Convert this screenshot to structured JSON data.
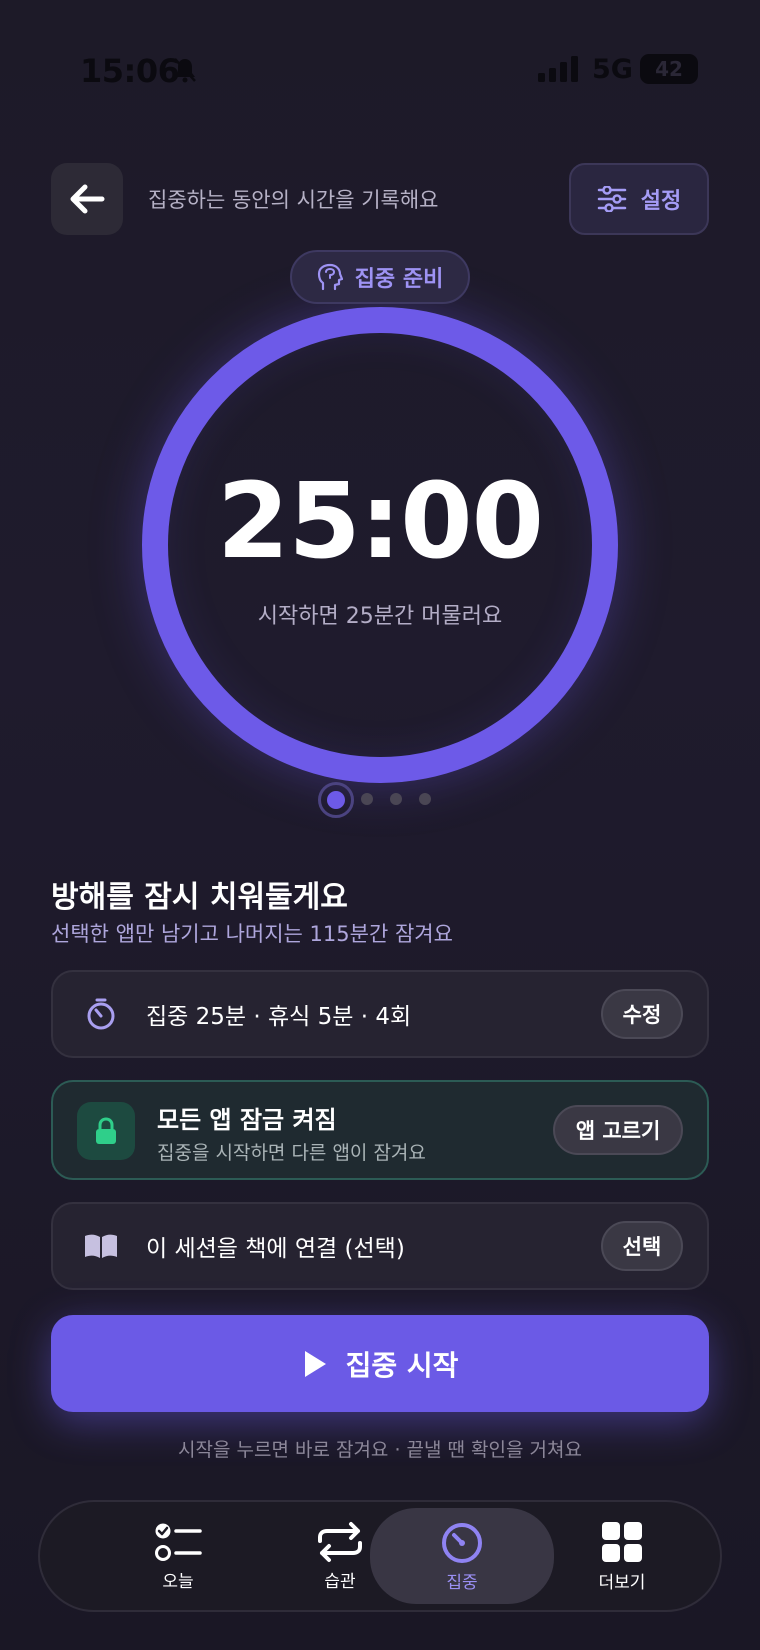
{
  "status_bar": {
    "time": "15:06",
    "network": "5G",
    "battery": "42"
  },
  "header": {
    "subtitle": "집중하는 동안의 시간을 기록해요",
    "settings_label": "설정"
  },
  "timer": {
    "chip_label": "집중 준비",
    "display": "25:00",
    "subtitle": "시작하면 25분간 머물러요",
    "progress": 1.0
  },
  "pager": {
    "count": 4,
    "active_index": 0
  },
  "section": {
    "title": "방해를 잠시 치워둘게요",
    "subtitle": "선택한 앱만 남기고 나머지는 115분간 잠겨요"
  },
  "cards": {
    "schedule": {
      "text": "집중 25분 · 휴식 5분 · 4회",
      "button": "수정"
    },
    "lock": {
      "title": "모든 앱 잠금 켜짐",
      "subtitle": "집중을 시작하면 다른 앱이 잠겨요",
      "button": "앱 고르기"
    },
    "book": {
      "text": "이 세션을 책에 연결 (선택)",
      "button": "선택"
    }
  },
  "start": {
    "label": "집중 시작",
    "hint": "시작을 누르면 바로 잠겨요 · 끝낼 땐 확인을 거쳐요"
  },
  "nav": {
    "items": [
      {
        "label": "오늘",
        "icon": "checklist-icon"
      },
      {
        "label": "습관",
        "icon": "repeat-icon"
      },
      {
        "label": "집중",
        "icon": "timer-icon",
        "active": true
      },
      {
        "label": "더보기",
        "icon": "grid-icon"
      }
    ]
  },
  "colors": {
    "accent": "#6d5ae8",
    "background": "#1f1b2d",
    "lock_green": "#2fcf8a"
  }
}
